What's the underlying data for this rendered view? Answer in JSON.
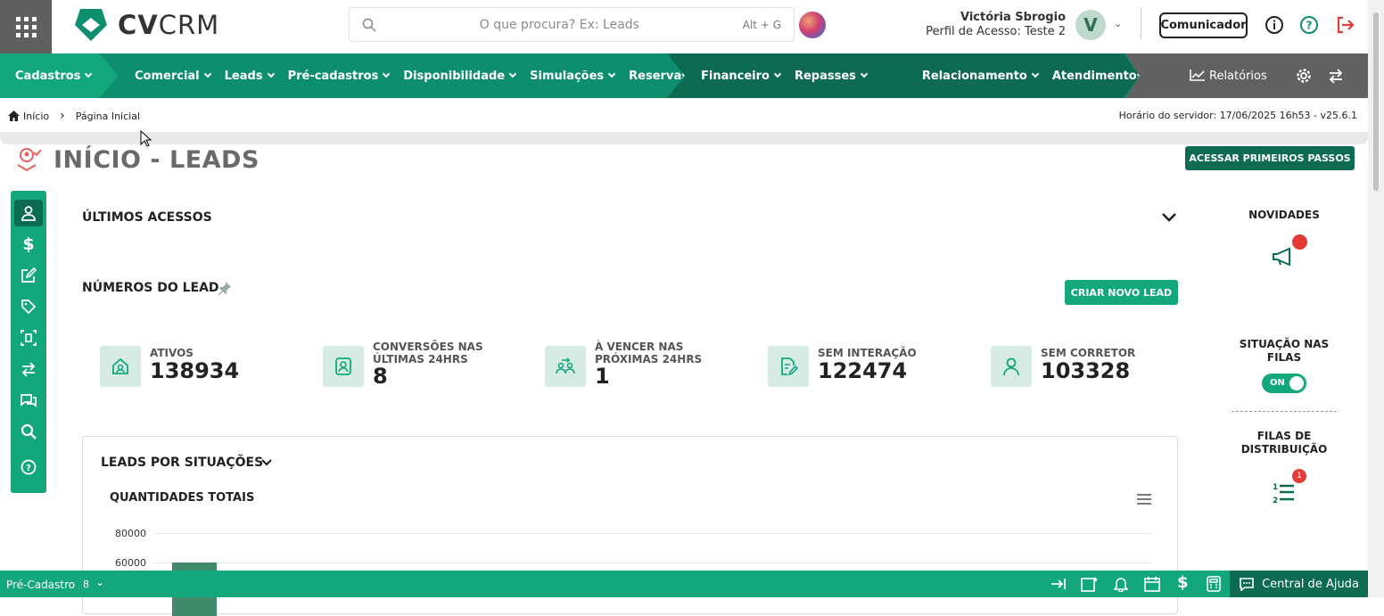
{
  "search": {
    "placeholder": "O que procura? Ex: Leads",
    "shortcut": "Alt + G"
  },
  "user": {
    "name": "Victória Sbrogio",
    "profile": "Perfil de Acesso: Teste 2",
    "initial": "V"
  },
  "header": {
    "communicator": "Comunicador",
    "logo_bold": "CV",
    "logo_light": "CRM"
  },
  "nav": {
    "seg1": [
      "Cadastros"
    ],
    "seg2": [
      "Comercial",
      "Leads",
      "Pré-cadastros",
      "Disponibilidade",
      "Simulações",
      "Reservas"
    ],
    "seg3": [
      "Financeiro",
      "Repasses"
    ],
    "seg4": [
      "Relacionamento",
      "Atendimentos"
    ],
    "reports": "Relatórios"
  },
  "breadcrumb": {
    "home": "Início",
    "current": "Página Inicial",
    "server": "Horário do servidor: 17/06/2025 16h53 - v25.6.1"
  },
  "page": {
    "title": "INÍCIO - LEADS",
    "first_steps": "ACESSAR PRIMEIROS PASSOS"
  },
  "sections": {
    "last_access": "ÚLTIMOS ACESSOS",
    "lead_numbers": "NÚMEROS DO LEAD",
    "new_lead": "CRIAR NOVO LEAD",
    "by_status": "LEADS POR SITUAÇÕES",
    "totals": "QUANTIDADES TOTAIS"
  },
  "kpis": [
    {
      "label": "ATIVOS",
      "value": "138934"
    },
    {
      "label": "CONVERSÕES NAS ÚLTIMAS 24HRS",
      "value": "8"
    },
    {
      "label": "À VENCER NAS PRÓXIMAS 24HRS",
      "value": "1"
    },
    {
      "label": "SEM INTERAÇÃO",
      "value": "122474"
    },
    {
      "label": "SEM CORRETOR",
      "value": "103328"
    }
  ],
  "right": {
    "news": "NOVIDADES",
    "queues": "SITUAÇÃO NAS FILAS",
    "toggle": "ON",
    "distribution": "FILAS DE DISTRIBUIÇÃO",
    "dist_badge": "1"
  },
  "chart_data": {
    "type": "bar",
    "title": "QUANTIDADES TOTAIS",
    "ticks": [
      "80000",
      "60000"
    ]
  },
  "bottom": {
    "precad": "Pré-Cadastro",
    "precad_count": "8",
    "help": "Central de Ajuda"
  },
  "colors": {
    "primary": "#0d8f6f",
    "dark": "#0d6b52",
    "accent": "#13a87c"
  }
}
